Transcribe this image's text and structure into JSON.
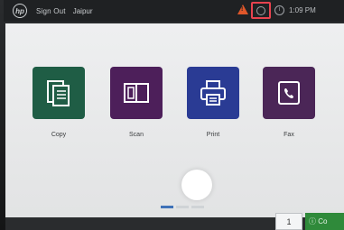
{
  "topbar": {
    "logo": "hp",
    "sign_out_label": "Sign Out",
    "user_name": "Jaipur",
    "time": "1:09 PM",
    "icons": [
      "hp-logo-icon",
      "warning-icon",
      "status-icon",
      "info-icon"
    ]
  },
  "home": {
    "apps": [
      {
        "label": "Copy",
        "icon": "copy-icon",
        "color": "#1f5d45"
      },
      {
        "label": "Scan",
        "icon": "scan-icon",
        "color": "#4d1f5a"
      },
      {
        "label": "Print",
        "icon": "print-icon",
        "color": "#2a3b94"
      },
      {
        "label": "Fax",
        "icon": "fax-icon",
        "color": "#4b2657"
      }
    ],
    "page_indicator": {
      "pages": 3,
      "active": 1
    }
  },
  "bottom": {
    "copies_value": "1",
    "start_copy_label": "ⓘ Co"
  },
  "colors": {
    "warning": "#e0572a",
    "highlight": "#e8434f",
    "start": "#2f8a3a"
  }
}
